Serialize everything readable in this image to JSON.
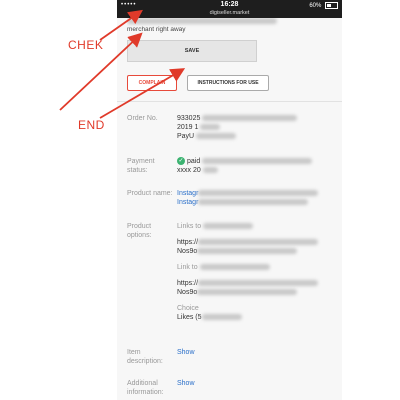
{
  "status_bar": {
    "time": "16:28",
    "url": "digiseller.market",
    "battery": "60%",
    "signal": "••••• "
  },
  "top_note": "merchant right away",
  "buttons": {
    "save": "SAVE",
    "complain": "COMPLAIN",
    "instructions": "INSTRUCTIONS FOR USE"
  },
  "order": {
    "order_no_label": "Order No.",
    "order_no_value": "933025",
    "order_no_date": "2019 1",
    "order_no_pay": "PayU",
    "payment_label": "Payment status:",
    "payment_value": "paid",
    "payment_extra": "xxxx 20",
    "product_name_label": "Product name:",
    "product_name_value": "Instagr",
    "product_name_value2": "Instagr",
    "product_options_label": "Product options:",
    "options": {
      "links_label": "Links to",
      "link1_prefix": "https://",
      "link1_suffix": "Nos9o",
      "link_to_label": "Link to",
      "link2_prefix": "https://",
      "link2_suffix": "Nos9o",
      "choice_label": "Choice",
      "likes": "Likes (5"
    },
    "item_description_label": "Item description:",
    "item_description_action": "Show",
    "additional_info_label": "Additional information:",
    "additional_info_action": "Show"
  },
  "annotations": {
    "chek": "CHEK",
    "end": "END",
    "color": "#e03a2a"
  }
}
